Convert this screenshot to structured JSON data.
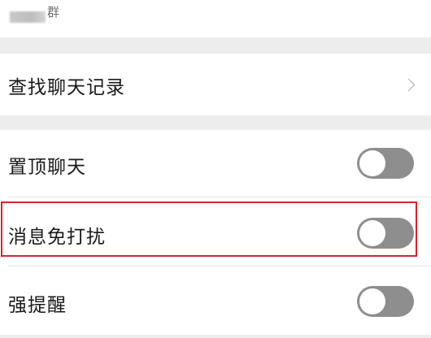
{
  "top": {
    "name_fragment": "群"
  },
  "items": {
    "search_history": "查找聊天记录",
    "pin_chat": "置顶聊天",
    "mute": "消息免打扰",
    "strong_reminder": "强提醒"
  },
  "toggles": {
    "pin_chat": false,
    "mute": false,
    "strong_reminder": false
  },
  "colors": {
    "background": "#ededed",
    "toggle_off": "#8e8e8e",
    "highlight": "#d8242a"
  }
}
